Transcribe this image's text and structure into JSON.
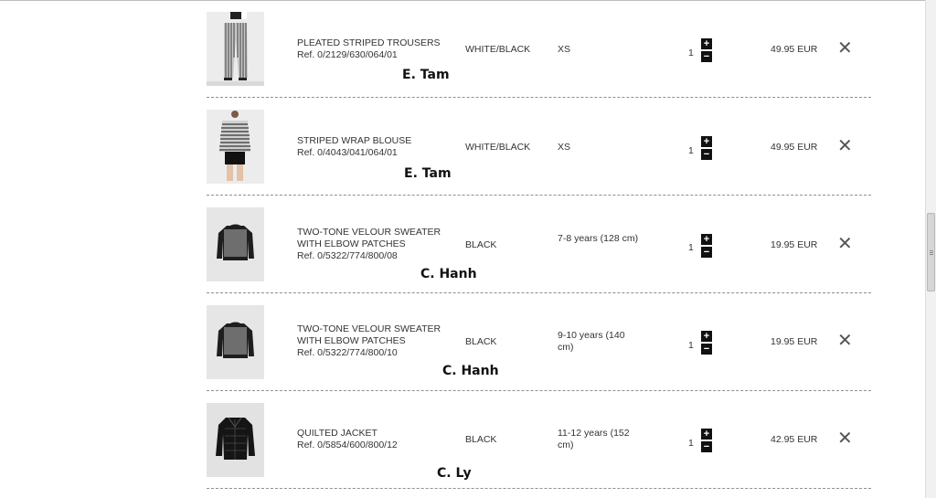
{
  "items": [
    {
      "name": "PLEATED STRIPED TROUSERS",
      "ref": "Ref. 0/2129/630/064/01",
      "color": "WHITE/BLACK",
      "size": "XS",
      "qty": "1",
      "price": "49.95 EUR",
      "annotation": "E. Tam",
      "image": "striped-trousers-photo"
    },
    {
      "name": "STRIPED WRAP BLOUSE",
      "ref": "Ref. 0/4043/041/064/01",
      "color": "WHITE/BLACK",
      "size": "XS",
      "qty": "1",
      "price": "49.95 EUR",
      "annotation": "E. Tam",
      "image": "striped-blouse-photo"
    },
    {
      "name": "TWO-TONE VELOUR SWEATER WITH ELBOW PATCHES",
      "ref": "Ref. 0/5322/774/800/08",
      "color": "BLACK",
      "size": "7-8 years (128 cm)",
      "qty": "1",
      "price": "19.95 EUR",
      "annotation": "C. Hanh",
      "image": "sweater-photo"
    },
    {
      "name": "TWO-TONE VELOUR SWEATER WITH ELBOW PATCHES",
      "ref": "Ref. 0/5322/774/800/10",
      "color": "BLACK",
      "size": "9-10 years (140 cm)",
      "qty": "1",
      "price": "19.95 EUR",
      "annotation": "C. Hanh",
      "image": "sweater-photo"
    },
    {
      "name": "QUILTED JACKET",
      "ref": "Ref. 0/5854/600/800/12",
      "color": "BLACK",
      "size": "11-12 years (152 cm)",
      "qty": "1",
      "price": "42.95 EUR",
      "annotation": "C. Ly",
      "image": "quilted-jacket-photo"
    }
  ],
  "controls": {
    "plus": "+",
    "minus": "−",
    "remove": "✕"
  },
  "colors": {
    "stepper": "#111111",
    "separator": "#8f8f8f",
    "text": "#333333"
  }
}
